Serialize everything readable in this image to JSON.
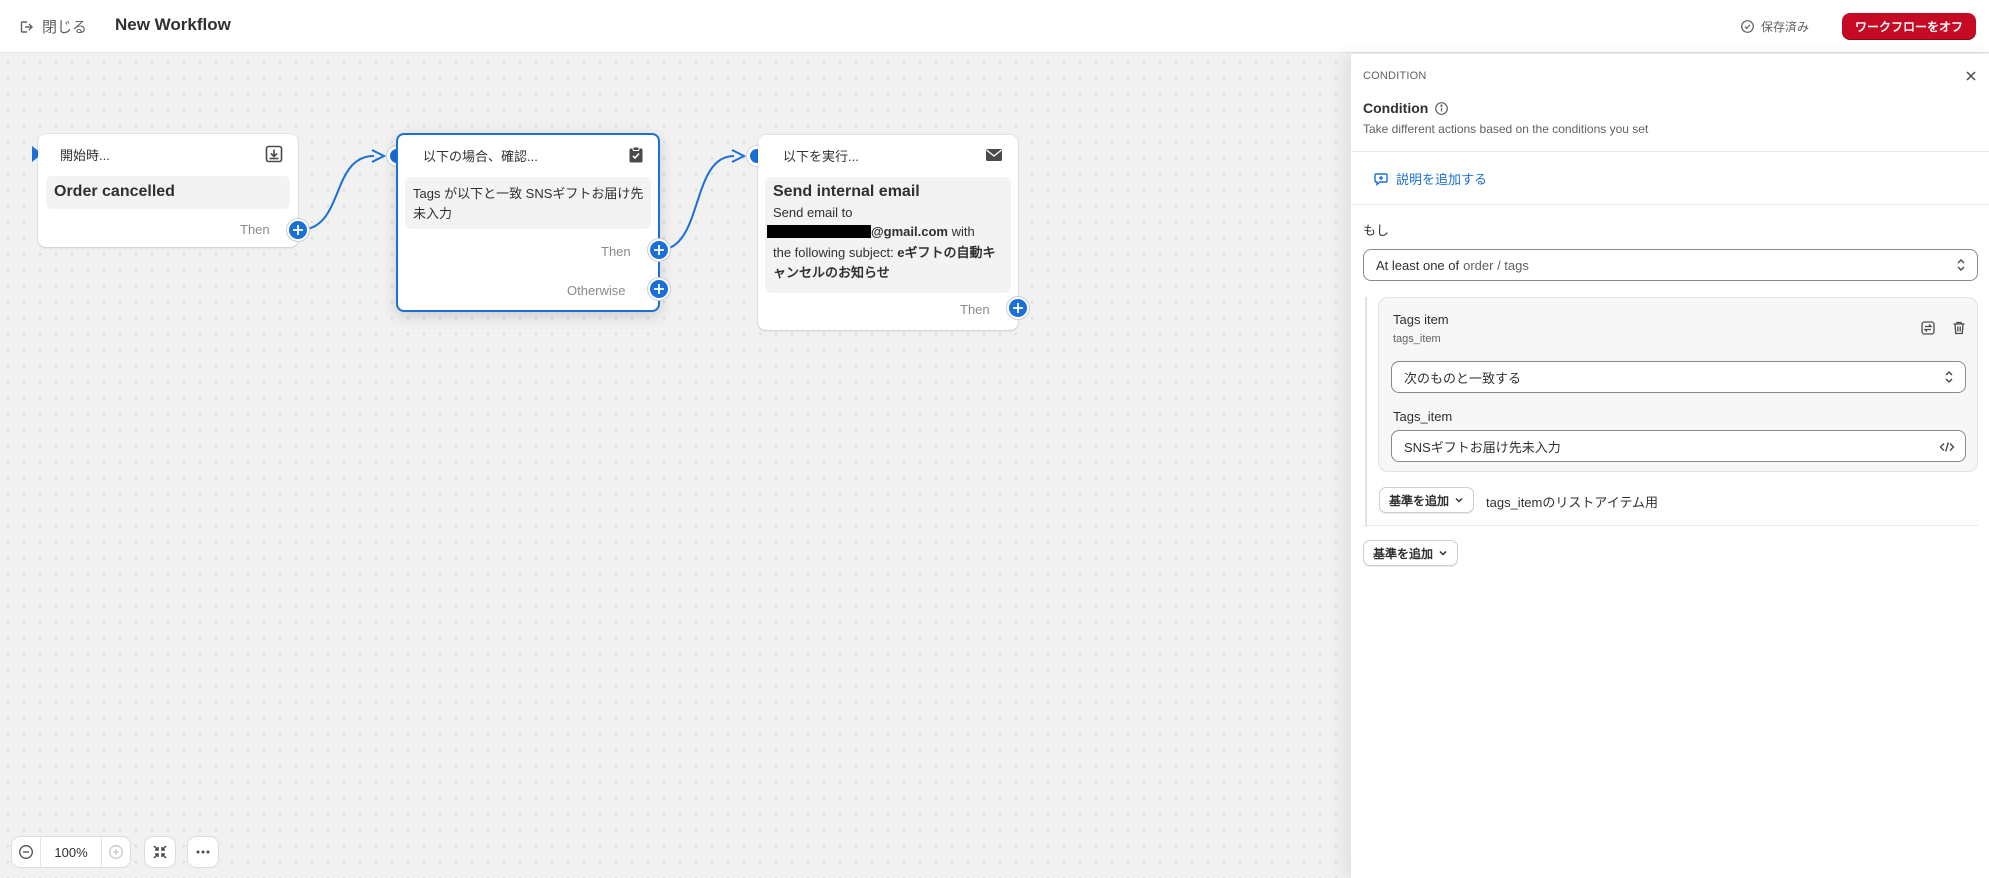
{
  "topbar": {
    "close_label": "閉じる",
    "title": "New Workflow",
    "saved_label": "保存済み",
    "turn_off_label": "ワークフローをオフ"
  },
  "nodes": {
    "trigger": {
      "header": "開始時...",
      "body": "Order cancelled",
      "then_label": "Then",
      "icon": "download-icon"
    },
    "condition": {
      "header": "以下の場合、確認...",
      "body": "Tags が以下と一致 SNSギフトお届け先未入力",
      "then_label": "Then",
      "otherwise_label": "Otherwise",
      "icon": "clipboard-check-icon"
    },
    "action": {
      "header": "以下を実行...",
      "title": "Send internal email",
      "line1": "Send email to",
      "email_visible": "@gmail.com",
      "line2_rest": " with",
      "line3_prefix": "the following subject: ",
      "subject": "eギフトの自動キャンセルのお知らせ",
      "then_label": "Then",
      "icon": "mail-icon"
    }
  },
  "zoom": {
    "value": "100%"
  },
  "panel": {
    "kicker": "CONDITION",
    "title": "Condition",
    "subtitle": "Take different actions based on the conditions you set",
    "add_description": "説明を追加する",
    "if_label": "もし",
    "quantifier_select": {
      "strong": "At least one of",
      "path": "order / tags"
    },
    "criterion": {
      "title": "Tags item",
      "subtitle": "tags_item",
      "operator": "次のものと一致する",
      "field_label": "Tags_item",
      "value": "SNSギフトお届け先未入力"
    },
    "add_criterion_inner": "基準を追加",
    "inner_note": "tags_itemのリストアイテム用",
    "add_criterion_outer": "基準を追加"
  },
  "colors": {
    "accent": "#1a6fd8",
    "danger": "#c70a24",
    "canvas": "#f1f1f1"
  }
}
